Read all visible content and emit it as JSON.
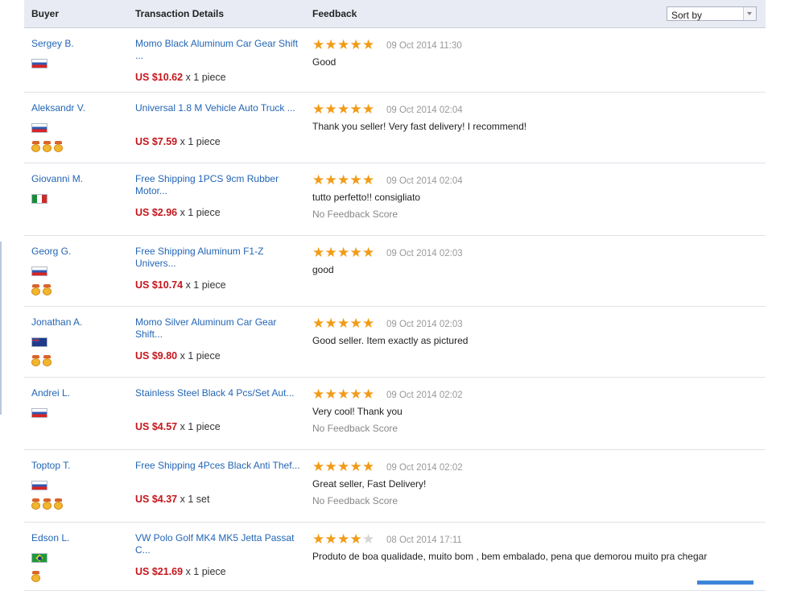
{
  "header": {
    "buyer_label": "Buyer",
    "transaction_label": "Transaction Details",
    "feedback_label": "Feedback",
    "sort_label": "Sort by"
  },
  "rows": [
    {
      "buyer": "Sergey B.",
      "flag": "russia",
      "medals": 0,
      "product": "Momo Black Aluminum Car Gear Shift ...",
      "price": "US $10.62",
      "qty": "x 1 piece",
      "rating": 5,
      "date": "09 Oct 2014 11:30",
      "comment": "Good",
      "score": ""
    },
    {
      "buyer": "Aleksandr V.",
      "flag": "russia",
      "medals": 3,
      "product": "Universal 1.8 M Vehicle Auto Truck ...",
      "price": "US $7.59",
      "qty": "x 1 piece",
      "rating": 5,
      "date": "09 Oct 2014 02:04",
      "comment": "Thank you seller! Very fast delivery! I recommend!",
      "score": ""
    },
    {
      "buyer": "Giovanni M.",
      "flag": "italy",
      "medals": 0,
      "product": "Free Shipping 1PCS 9cm Rubber Motor...",
      "price": "US $2.96",
      "qty": "x 1 piece",
      "rating": 5,
      "date": "09 Oct 2014 02:04",
      "comment": "tutto perfetto!! consigliato",
      "score": "No Feedback Score"
    },
    {
      "buyer": "Georg G.",
      "flag": "russia",
      "medals": 2,
      "product": "Free Shipping Aluminum F1-Z Univers...",
      "price": "US $10.74",
      "qty": "x 1 piece",
      "rating": 5,
      "date": "09 Oct 2014 02:03",
      "comment": "good",
      "score": ""
    },
    {
      "buyer": "Jonathan A.",
      "flag": "australia",
      "medals": 2,
      "product": "Momo Silver Aluminum Car Gear Shift...",
      "price": "US $9.80",
      "qty": "x 1 piece",
      "rating": 5,
      "date": "09 Oct 2014 02:03",
      "comment": "Good seller. Item exactly as pictured",
      "score": ""
    },
    {
      "buyer": "Andrei L.",
      "flag": "russia",
      "medals": 0,
      "product": "Stainless Steel Black 4 Pcs/Set Aut...",
      "price": "US $4.57",
      "qty": "x 1 piece",
      "rating": 5,
      "date": "09 Oct 2014 02:02",
      "comment": "Very cool! Thank you",
      "score": "No Feedback Score"
    },
    {
      "buyer": "Toptop T.",
      "flag": "russia",
      "medals": 3,
      "product": "Free Shipping 4Pces Black Anti Thef...",
      "price": "US $4.37",
      "qty": "x 1 set",
      "rating": 5,
      "date": "09 Oct 2014 02:02",
      "comment": "Great seller, Fast Delivery!",
      "score": "No Feedback Score"
    },
    {
      "buyer": "Edson L.",
      "flag": "brazil",
      "medals": 1,
      "product": "VW Polo Golf MK4 MK5 Jetta Passat C...",
      "price": "US $21.69",
      "qty": "x 1 piece",
      "rating": 4,
      "date": "08 Oct 2014 17:11",
      "comment": "Produto de boa qualidade, muito bom , bem embalado, pena que demorou muito pra chegar",
      "score": ""
    }
  ],
  "colors": {
    "accent_link": "#2366b5",
    "price": "#c4161c",
    "star": "#f29b17"
  }
}
